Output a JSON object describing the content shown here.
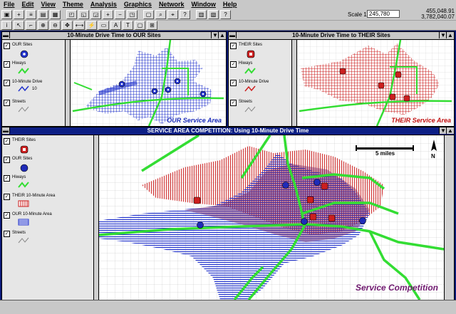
{
  "menu": [
    "File",
    "Edit",
    "View",
    "Theme",
    "Analysis",
    "Graphics",
    "Network",
    "Window",
    "Help"
  ],
  "toolbar": {
    "scale_label": "Scale 1:",
    "scale_value": "245,780",
    "coord_x": "455,048.91",
    "coord_y": "3,782,040.07"
  },
  "views": {
    "ours": {
      "title": "10-Minute Drive Time to OUR Sites",
      "layers": [
        "OUR Sites",
        "Hiways",
        "10-Minute Drive",
        "Streets"
      ],
      "sublabel": "10",
      "map_label": "OUR Service Area"
    },
    "theirs": {
      "title": "10-Minute Drive Time to THEIR Sites",
      "layers": [
        "THEIR Sites",
        "Hiways",
        "10-Minute Drive",
        "Streets"
      ],
      "map_label": "THEIR Service Area"
    },
    "competition": {
      "title": "SERVICE AREA COMPETITION:  Using 10-Minute Drive Time",
      "layers": [
        "THEIR Sites",
        "OUR Sites",
        "Hiways",
        "THEIR 10-Minute Area",
        "OUR 10-Minute Area",
        "Streets"
      ],
      "scalebar": "5 miles",
      "north": "N",
      "map_label": "Service Competition"
    }
  },
  "colors": {
    "ours": "#2233cc",
    "theirs": "#cc1f1f",
    "highway": "#33dd33",
    "overlap": "#7a2a6a",
    "label_blue": "#1a2ab8",
    "label_red": "#c01010",
    "label_purple": "#701a70"
  }
}
